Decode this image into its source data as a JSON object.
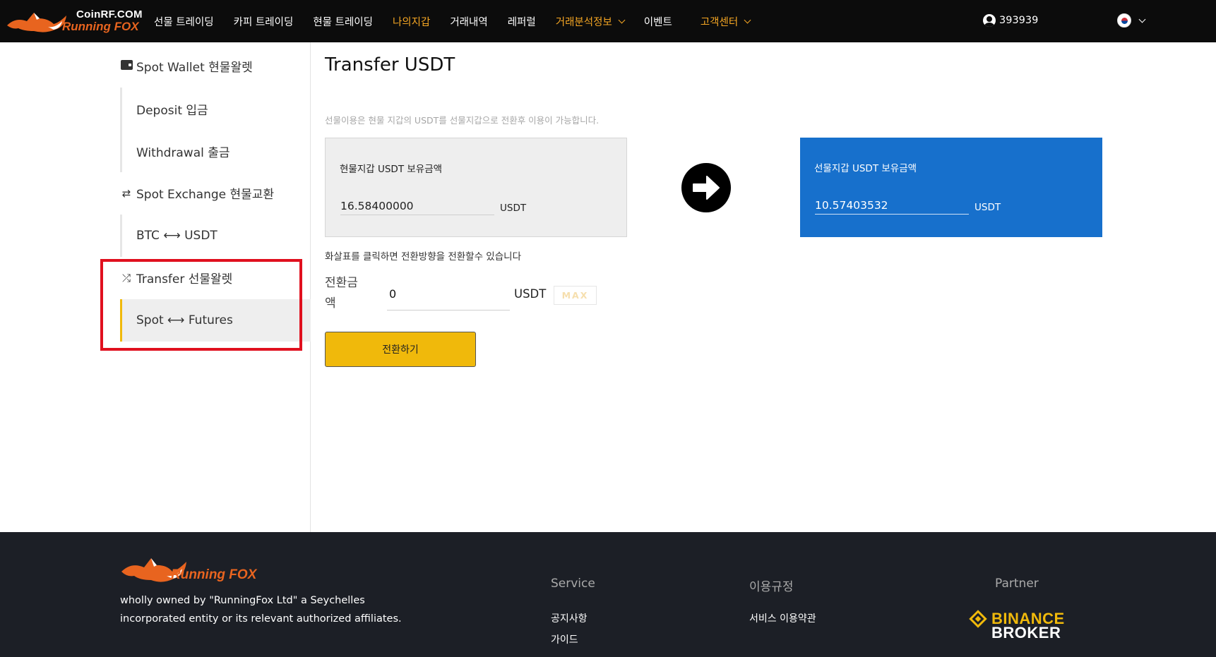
{
  "brand": {
    "name_top": "CoinRF.COM",
    "name_bottom": "Running FOX",
    "accent_color": "#f0b90b",
    "fox_color": "#e8641f"
  },
  "nav": {
    "items": [
      {
        "label": "선물 트레이딩",
        "highlight": false
      },
      {
        "label": "카피 트레이딩",
        "highlight": false
      },
      {
        "label": "현물 트레이딩",
        "highlight": false
      },
      {
        "label": "나의지갑",
        "highlight": true
      },
      {
        "label": "거래내역",
        "highlight": false
      },
      {
        "label": "레퍼럴",
        "highlight": false
      },
      {
        "label": "거래분석정보",
        "highlight": true,
        "dropdown": true
      },
      {
        "label": "이벤트",
        "highlight": false
      },
      {
        "label": "고객센터",
        "highlight": true,
        "dropdown": true
      }
    ],
    "user_id": "393939",
    "language": "Korean"
  },
  "sidebar": {
    "spot_wallet": "Spot Wallet 현물왈렛",
    "deposit": "Deposit 입금",
    "withdrawal": "Withdrawal 출금",
    "spot_exchange": "Spot Exchange 현물교환",
    "btc_usdt": "BTC ⟷ USDT",
    "transfer": "Transfer 선물왈렛",
    "spot_futures": "Spot ⟷ Futures"
  },
  "main": {
    "title": "Transfer USDT",
    "note": "선물이용은 현물 지갑의 USDT를 선물지갑으로 전환후 이용이 가능합니다.",
    "spot_card": {
      "label": "현물지갑 USDT 보유금액",
      "value": "16.58400000",
      "unit": "USDT"
    },
    "futures_card": {
      "label": "선물지갑 USDT 보유금액",
      "value": "10.57403532",
      "unit": "USDT"
    },
    "hint": "화살표를 클릭하면 전환방향을 전환할수 있습니다",
    "amount_label": "전환금액",
    "amount_value": "0",
    "amount_unit": "USDT",
    "max_label": "MAX",
    "transfer_button": "전환하기"
  },
  "footer": {
    "logo_text": "Running FOX",
    "description": "wholly owned by \"RunningFox Ltd\" a Seychelles incorporated entity or its relevant authorized affiliates.",
    "service_heading": "Service",
    "service_links": [
      "공지사항",
      "가이드"
    ],
    "terms_heading": "이용규정",
    "terms_links": [
      "서비스 이용약관"
    ],
    "partner_heading": "Partner",
    "partner_name_top": "BINANCE",
    "partner_name_bottom": "BROKER"
  }
}
